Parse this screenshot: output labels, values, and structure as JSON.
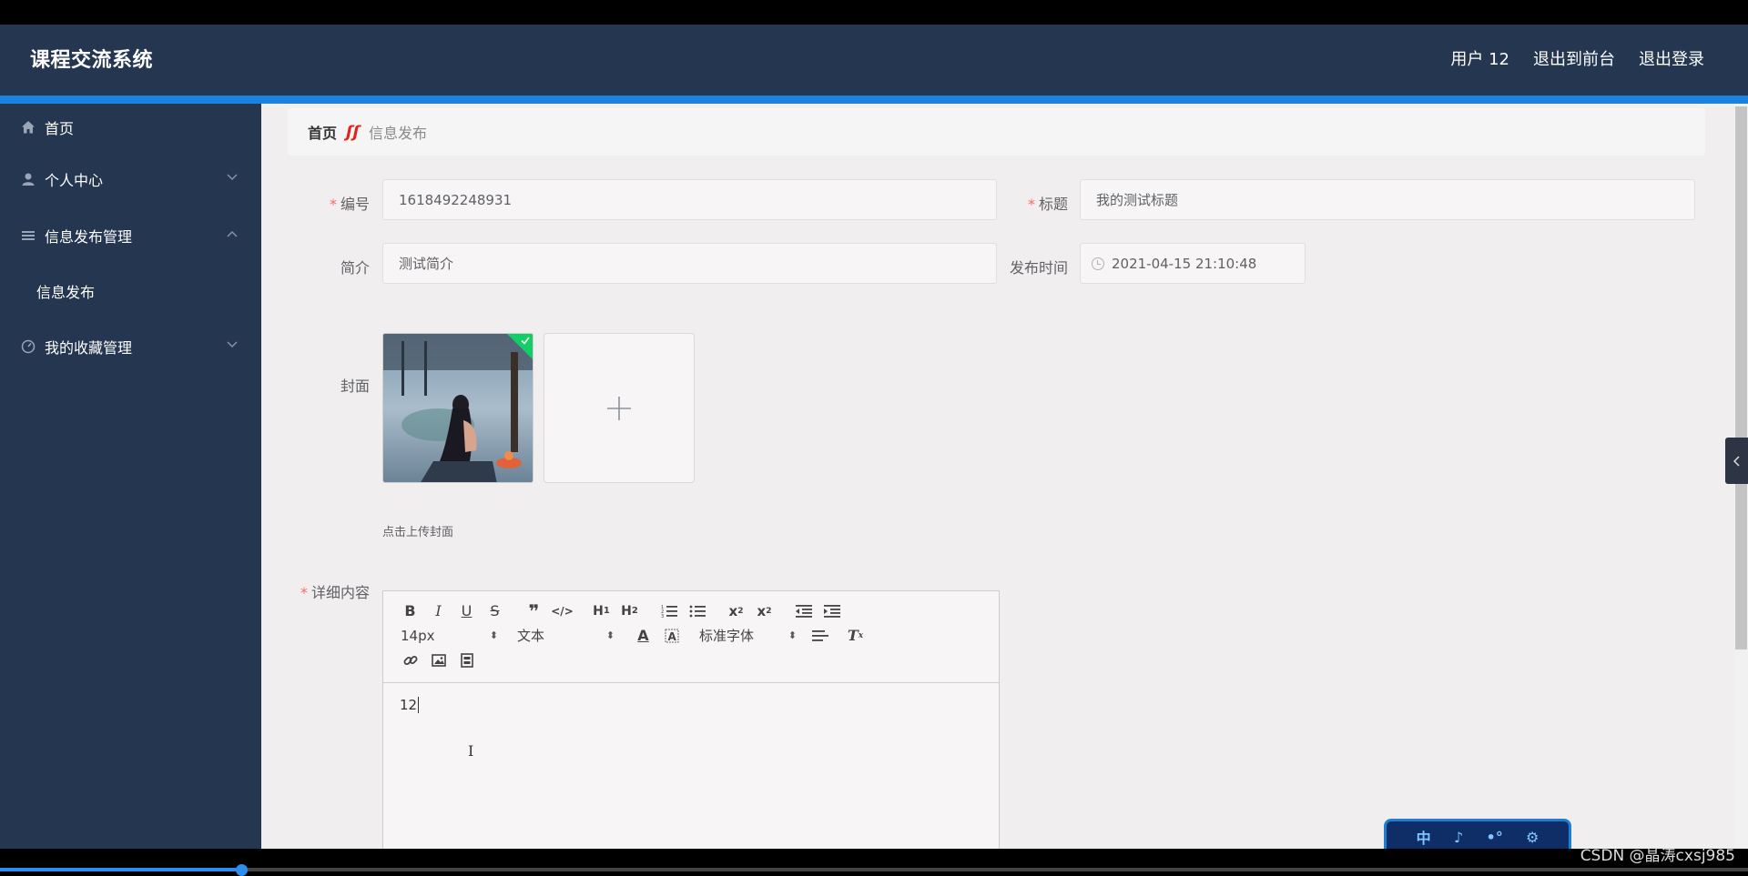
{
  "app": {
    "title": "课程交流系统",
    "user": "用户 12",
    "back_to_front": "退出到前台",
    "logout": "退出登录"
  },
  "sidebar": {
    "items": [
      {
        "label": "首页",
        "icon": "home-icon"
      },
      {
        "label": "个人中心",
        "icon": "user-icon"
      },
      {
        "label": "信息发布管理",
        "icon": "list-icon",
        "expanded": true
      },
      {
        "label": "信息发布"
      },
      {
        "label": "我的收藏管理",
        "icon": "gauge-icon"
      }
    ]
  },
  "breadcrumb": {
    "home": "首页",
    "separator": "ʃʃ",
    "current": "信息发布"
  },
  "form": {
    "number_label": "编号",
    "number_value": "1618492248931",
    "title_label": "标题",
    "title_value": "我的测试标题",
    "intro_label": "简介",
    "intro_value": "测试简介",
    "time_label": "发布时间",
    "time_value": "2021-04-15 21:10:48",
    "cover_label": "封面",
    "cover_hint": "点击上传封面",
    "upload_plus": "+",
    "detail_label": "详细内容"
  },
  "editor": {
    "font_size": "14px",
    "paragraph": "文本",
    "font_family": "标准字体",
    "content": "12"
  },
  "widget": {
    "glyphs": [
      "中",
      "♪",
      "•°",
      "⚙"
    ]
  },
  "watermark": "CSDN @晶涛cxsj985",
  "colors": {
    "topbar": "#243650",
    "accent": "#1a82e0",
    "required": "#f56c6c",
    "upload_success": "#13ce66"
  }
}
